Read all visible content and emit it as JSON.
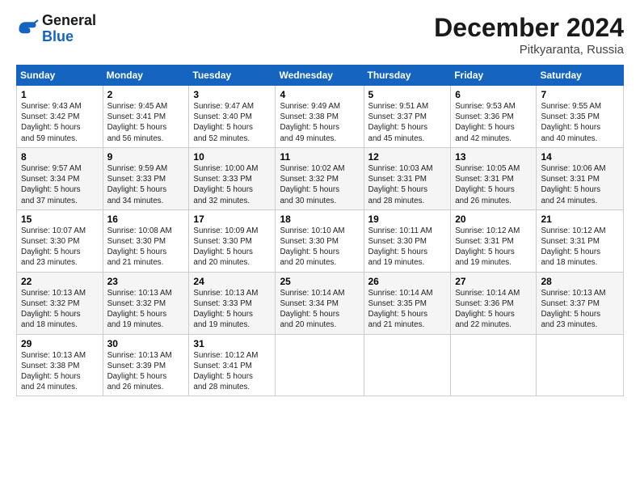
{
  "logo": {
    "general": "General",
    "blue": "Blue"
  },
  "header": {
    "month_title": "December 2024",
    "location": "Pitkyaranta, Russia"
  },
  "weekdays": [
    "Sunday",
    "Monday",
    "Tuesday",
    "Wednesday",
    "Thursday",
    "Friday",
    "Saturday"
  ],
  "weeks": [
    [
      {
        "day": "1",
        "info": "Sunrise: 9:43 AM\nSunset: 3:42 PM\nDaylight: 5 hours\nand 59 minutes."
      },
      {
        "day": "2",
        "info": "Sunrise: 9:45 AM\nSunset: 3:41 PM\nDaylight: 5 hours\nand 56 minutes."
      },
      {
        "day": "3",
        "info": "Sunrise: 9:47 AM\nSunset: 3:40 PM\nDaylight: 5 hours\nand 52 minutes."
      },
      {
        "day": "4",
        "info": "Sunrise: 9:49 AM\nSunset: 3:38 PM\nDaylight: 5 hours\nand 49 minutes."
      },
      {
        "day": "5",
        "info": "Sunrise: 9:51 AM\nSunset: 3:37 PM\nDaylight: 5 hours\nand 45 minutes."
      },
      {
        "day": "6",
        "info": "Sunrise: 9:53 AM\nSunset: 3:36 PM\nDaylight: 5 hours\nand 42 minutes."
      },
      {
        "day": "7",
        "info": "Sunrise: 9:55 AM\nSunset: 3:35 PM\nDaylight: 5 hours\nand 40 minutes."
      }
    ],
    [
      {
        "day": "8",
        "info": "Sunrise: 9:57 AM\nSunset: 3:34 PM\nDaylight: 5 hours\nand 37 minutes."
      },
      {
        "day": "9",
        "info": "Sunrise: 9:59 AM\nSunset: 3:33 PM\nDaylight: 5 hours\nand 34 minutes."
      },
      {
        "day": "10",
        "info": "Sunrise: 10:00 AM\nSunset: 3:33 PM\nDaylight: 5 hours\nand 32 minutes."
      },
      {
        "day": "11",
        "info": "Sunrise: 10:02 AM\nSunset: 3:32 PM\nDaylight: 5 hours\nand 30 minutes."
      },
      {
        "day": "12",
        "info": "Sunrise: 10:03 AM\nSunset: 3:31 PM\nDaylight: 5 hours\nand 28 minutes."
      },
      {
        "day": "13",
        "info": "Sunrise: 10:05 AM\nSunset: 3:31 PM\nDaylight: 5 hours\nand 26 minutes."
      },
      {
        "day": "14",
        "info": "Sunrise: 10:06 AM\nSunset: 3:31 PM\nDaylight: 5 hours\nand 24 minutes."
      }
    ],
    [
      {
        "day": "15",
        "info": "Sunrise: 10:07 AM\nSunset: 3:30 PM\nDaylight: 5 hours\nand 23 minutes."
      },
      {
        "day": "16",
        "info": "Sunrise: 10:08 AM\nSunset: 3:30 PM\nDaylight: 5 hours\nand 21 minutes."
      },
      {
        "day": "17",
        "info": "Sunrise: 10:09 AM\nSunset: 3:30 PM\nDaylight: 5 hours\nand 20 minutes."
      },
      {
        "day": "18",
        "info": "Sunrise: 10:10 AM\nSunset: 3:30 PM\nDaylight: 5 hours\nand 20 minutes."
      },
      {
        "day": "19",
        "info": "Sunrise: 10:11 AM\nSunset: 3:30 PM\nDaylight: 5 hours\nand 19 minutes."
      },
      {
        "day": "20",
        "info": "Sunrise: 10:12 AM\nSunset: 3:31 PM\nDaylight: 5 hours\nand 19 minutes."
      },
      {
        "day": "21",
        "info": "Sunrise: 10:12 AM\nSunset: 3:31 PM\nDaylight: 5 hours\nand 18 minutes."
      }
    ],
    [
      {
        "day": "22",
        "info": "Sunrise: 10:13 AM\nSunset: 3:32 PM\nDaylight: 5 hours\nand 18 minutes."
      },
      {
        "day": "23",
        "info": "Sunrise: 10:13 AM\nSunset: 3:32 PM\nDaylight: 5 hours\nand 19 minutes."
      },
      {
        "day": "24",
        "info": "Sunrise: 10:13 AM\nSunset: 3:33 PM\nDaylight: 5 hours\nand 19 minutes."
      },
      {
        "day": "25",
        "info": "Sunrise: 10:14 AM\nSunset: 3:34 PM\nDaylight: 5 hours\nand 20 minutes."
      },
      {
        "day": "26",
        "info": "Sunrise: 10:14 AM\nSunset: 3:35 PM\nDaylight: 5 hours\nand 21 minutes."
      },
      {
        "day": "27",
        "info": "Sunrise: 10:14 AM\nSunset: 3:36 PM\nDaylight: 5 hours\nand 22 minutes."
      },
      {
        "day": "28",
        "info": "Sunrise: 10:13 AM\nSunset: 3:37 PM\nDaylight: 5 hours\nand 23 minutes."
      }
    ],
    [
      {
        "day": "29",
        "info": "Sunrise: 10:13 AM\nSunset: 3:38 PM\nDaylight: 5 hours\nand 24 minutes."
      },
      {
        "day": "30",
        "info": "Sunrise: 10:13 AM\nSunset: 3:39 PM\nDaylight: 5 hours\nand 26 minutes."
      },
      {
        "day": "31",
        "info": "Sunrise: 10:12 AM\nSunset: 3:41 PM\nDaylight: 5 hours\nand 28 minutes."
      },
      {
        "day": "",
        "info": ""
      },
      {
        "day": "",
        "info": ""
      },
      {
        "day": "",
        "info": ""
      },
      {
        "day": "",
        "info": ""
      }
    ]
  ]
}
